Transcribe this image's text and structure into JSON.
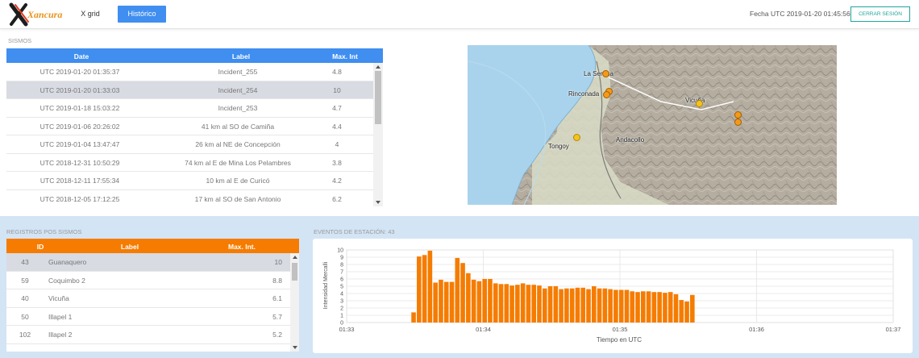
{
  "header": {
    "logo_text": "Xancura",
    "nav": [
      {
        "label": "X grid",
        "active": false
      },
      {
        "label": "Histórico",
        "active": true
      }
    ],
    "fecha": "Fecha UTC 2019-01-20 01:45:56",
    "logout_label": "CERRAR SESIÓN"
  },
  "colors": {
    "accent_blue": "#3f8ef0",
    "accent_orange": "#f57c00",
    "accent_teal": "#21a59b",
    "bottom_bg": "#d3e4f5"
  },
  "sismos": {
    "title": "SISMOS",
    "columns": [
      "Date",
      "Label",
      "Max. Int"
    ],
    "rows": [
      {
        "date": "UTC 2019-01-20 01:35:37",
        "label": "Incident_255",
        "max_int": "4.8",
        "selected": false
      },
      {
        "date": "UTC 2019-01-20 01:33:03",
        "label": "Incident_254",
        "max_int": "10",
        "selected": true
      },
      {
        "date": "UTC 2019-01-18 15:03:22",
        "label": "Incident_253",
        "max_int": "4.7",
        "selected": false
      },
      {
        "date": "UTC 2019-01-06 20:26:02",
        "label": "41 km al SO de Camiña",
        "max_int": "4.4",
        "selected": false
      },
      {
        "date": "UTC 2019-01-04 13:47:47",
        "label": "26 km al NE de Concepción",
        "max_int": "4",
        "selected": false
      },
      {
        "date": "UTC 2018-12-31 10:50:29",
        "label": "74 km al E de Mina Los Pelambres",
        "max_int": "3.8",
        "selected": false
      },
      {
        "date": "UTC 2018-12-11 17:55:34",
        "label": "10 km al E de Curicó",
        "max_int": "4.2",
        "selected": false
      },
      {
        "date": "UTC 2018-12-05 17:12:25",
        "label": "17 km al SO de San Antonio",
        "max_int": "6.2",
        "selected": false
      }
    ]
  },
  "map": {
    "labels": [
      "La Serena",
      "Rinconada",
      "Vicuña",
      "Tongoy",
      "Andacollo"
    ]
  },
  "registros": {
    "title": "REGISTROS POS SISMOS",
    "columns": [
      "ID",
      "Label",
      "Max. Int."
    ],
    "rows": [
      {
        "id": "43",
        "label": "Guanaquero",
        "max_int": "10",
        "selected": true
      },
      {
        "id": "59",
        "label": "Coquimbo 2",
        "max_int": "8.8",
        "selected": false
      },
      {
        "id": "40",
        "label": "Vicuña",
        "max_int": "6.1",
        "selected": false
      },
      {
        "id": "50",
        "label": "Illapel 1",
        "max_int": "5.7",
        "selected": false
      },
      {
        "id": "102",
        "label": "Illapel 2",
        "max_int": "5.2",
        "selected": false
      }
    ]
  },
  "eventos": {
    "title": "EVENTOS DE ESTACIÓN: 43"
  },
  "chart_data": {
    "type": "bar",
    "title": "",
    "xlabel": "Tiempo en UTC",
    "ylabel": "Intensidad Mercalli",
    "ylim": [
      0,
      10
    ],
    "yticks": [
      0,
      1,
      2,
      3,
      4,
      5,
      6,
      7,
      8,
      9,
      10
    ],
    "x_tick_labels": [
      "01:33",
      "01:34",
      "01:35",
      "01:36",
      "01:37"
    ],
    "x_ticks_minutes": [
      0,
      1,
      2,
      3,
      4
    ],
    "x_range_minutes": [
      0,
      4
    ],
    "bar_color": "#f57c00",
    "grid": true,
    "x_minutes": [
      0.49,
      0.53,
      0.57,
      0.61,
      0.65,
      0.69,
      0.73,
      0.77,
      0.81,
      0.85,
      0.89,
      0.93,
      0.97,
      1.01,
      1.05,
      1.09,
      1.13,
      1.17,
      1.21,
      1.25,
      1.29,
      1.33,
      1.37,
      1.41,
      1.45,
      1.49,
      1.53,
      1.57,
      1.61,
      1.65,
      1.69,
      1.73,
      1.77,
      1.81,
      1.85,
      1.89,
      1.93,
      1.97,
      2.01,
      2.05,
      2.09,
      2.13,
      2.17,
      2.21,
      2.25,
      2.29,
      2.33,
      2.37,
      2.41,
      2.45,
      2.49,
      2.53
    ],
    "values": [
      1.4,
      9.1,
      9.3,
      9.9,
      5.5,
      5.9,
      5.6,
      5.6,
      8.9,
      8.2,
      6.8,
      5.9,
      5.7,
      6.0,
      6.0,
      5.4,
      5.3,
      5.3,
      5.1,
      5.2,
      5.4,
      5.2,
      5.2,
      5.1,
      4.7,
      5.0,
      5.0,
      4.6,
      4.7,
      4.7,
      4.8,
      4.8,
      4.6,
      5.0,
      4.7,
      4.7,
      4.6,
      4.5,
      4.5,
      4.5,
      4.3,
      4.2,
      4.3,
      4.3,
      4.2,
      4.2,
      4.1,
      4.2,
      3.9,
      3.1,
      2.9,
      3.8
    ]
  }
}
